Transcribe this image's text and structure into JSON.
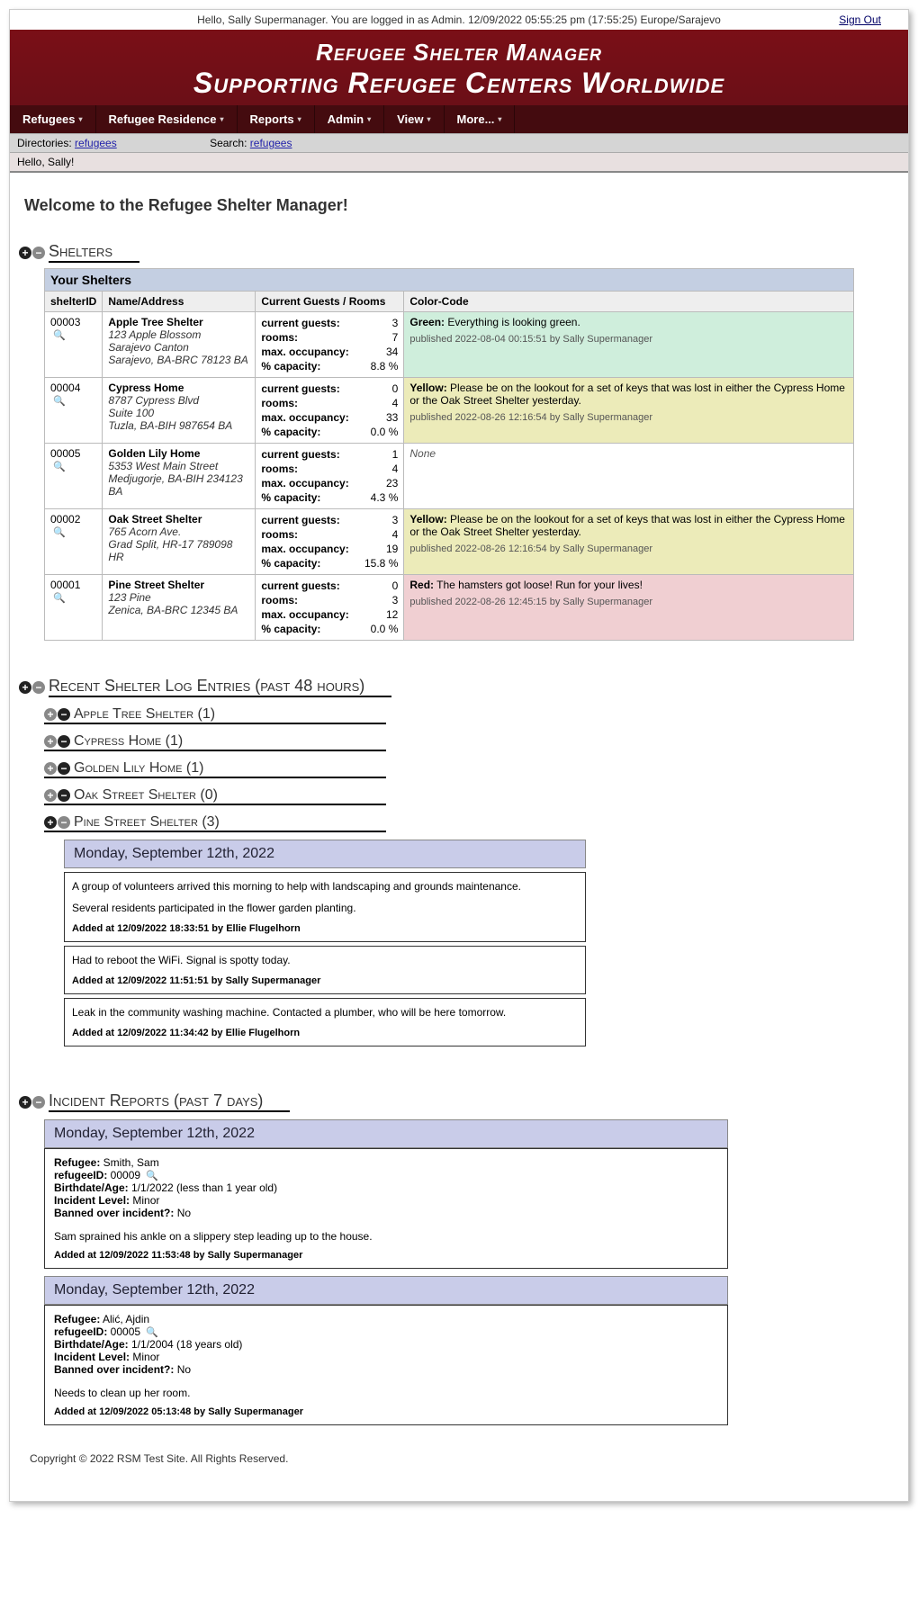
{
  "topbar": {
    "greeting": "Hello, Sally Supermanager. You are logged in as Admin. 12/09/2022 05:55:25 pm (17:55:25) Europe/Sarajevo",
    "signout": "Sign Out"
  },
  "header": {
    "title": "Refugee Shelter Manager",
    "subtitle": "Supporting Refugee Centers Worldwide"
  },
  "nav": [
    "Refugees",
    "Refugee Residence",
    "Reports",
    "Admin",
    "View",
    "More..."
  ],
  "dirbar": {
    "dir_label": "Directories:",
    "dir_link": "refugees",
    "search_label": "Search:",
    "search_link": "refugees"
  },
  "hello": "Hello, Sally!",
  "welcome": "Welcome to the Refugee Shelter Manager!",
  "sections": {
    "shelters": "Shelters",
    "recent": "Recent Shelter Log Entries (past 48 hours)",
    "incidents": "Incident Reports (past 7 days)"
  },
  "table": {
    "caption": "Your Shelters",
    "cols": {
      "id": "shelterID",
      "name": "Name/Address",
      "guests": "Current Guests / Rooms",
      "cc": "Color-Code"
    },
    "stat_labels": {
      "g": "current guests:",
      "r": "rooms:",
      "m": "max. occupancy:",
      "p": "% capacity:"
    }
  },
  "shelters": [
    {
      "id": "00003",
      "name": "Apple Tree Shelter",
      "addr": "123 Apple Blossom\nSarajevo Canton\nSarajevo, BA-BRC 78123 BA",
      "g": "3",
      "r": "7",
      "m": "34",
      "p": "8.8 %",
      "cc_class": "cc-green",
      "cc_label": "Green:",
      "cc_text": "Everything is looking green.",
      "cc_pub": "published 2022-08-04 00:15:51 by Sally Supermanager"
    },
    {
      "id": "00004",
      "name": "Cypress Home",
      "addr": "8787 Cypress Blvd\nSuite 100\nTuzla, BA-BIH 987654 BA",
      "g": "0",
      "r": "4",
      "m": "33",
      "p": "0.0 %",
      "cc_class": "cc-yellow",
      "cc_label": "Yellow:",
      "cc_text": "Please be on the lookout for a set of keys that was lost in either the Cypress Home or the Oak Street Shelter yesterday.",
      "cc_pub": "published 2022-08-26 12:16:54 by Sally Supermanager"
    },
    {
      "id": "00005",
      "name": "Golden Lily Home",
      "addr": "5353 West Main Street\nMedjugorje, BA-BIH 234123 BA",
      "g": "1",
      "r": "4",
      "m": "23",
      "p": "4.3 %",
      "cc_class": "",
      "cc_label": "",
      "cc_text": "None",
      "cc_pub": ""
    },
    {
      "id": "00002",
      "name": "Oak Street Shelter",
      "addr": "765 Acorn Ave.\nGrad Split, HR-17 789098 HR",
      "g": "3",
      "r": "4",
      "m": "19",
      "p": "15.8 %",
      "cc_class": "cc-yellow",
      "cc_label": "Yellow:",
      "cc_text": "Please be on the lookout for a set of keys that was lost in either the Cypress Home or the Oak Street Shelter yesterday.",
      "cc_pub": "published 2022-08-26 12:16:54 by Sally Supermanager"
    },
    {
      "id": "00001",
      "name": "Pine Street Shelter",
      "addr": "123 Pine\nZenica, BA-BRC 12345 BA",
      "g": "0",
      "r": "3",
      "m": "12",
      "p": "0.0 %",
      "cc_class": "cc-red",
      "cc_label": "Red:",
      "cc_text": "The hamsters got loose! Run for your lives!",
      "cc_pub": "published 2022-08-26 12:45:15 by Sally Supermanager"
    }
  ],
  "log_shelters": [
    "Apple Tree Shelter (1)",
    "Cypress Home (1)",
    "Golden Lily Home (1)",
    "Oak Street Shelter (0)",
    "Pine Street Shelter (3)"
  ],
  "log_date": "Monday, September 12th, 2022",
  "logs": [
    {
      "lines": [
        "A group of volunteers arrived this morning to help with landscaping and grounds maintenance.",
        "Several residents participated in the flower garden planting."
      ],
      "meta": "Added at 12/09/2022 18:33:51 by Ellie Flugelhorn"
    },
    {
      "lines": [
        "Had to reboot the WiFi. Signal is spotty today."
      ],
      "meta": "Added at 12/09/2022 11:51:51 by Sally Supermanager"
    },
    {
      "lines": [
        "Leak in the community washing machine. Contacted a plumber, who will be here tomorrow."
      ],
      "meta": "Added at 12/09/2022 11:34:42 by Ellie Flugelhorn"
    }
  ],
  "inc_date": "Monday, September 12th, 2022",
  "incidents": [
    {
      "refugee": "Smith, Sam",
      "rid": "00009",
      "birth": "1/1/2022 (less than 1 year old)",
      "level": "Minor",
      "banned": "No",
      "desc": "Sam sprained his ankle on a slippery step leading up to the house.",
      "meta": "Added at 12/09/2022 11:53:48 by Sally Supermanager"
    },
    {
      "refugee": "Alić, Ajdin",
      "rid": "00005",
      "birth": "1/1/2004 (18 years old)",
      "level": "Minor",
      "banned": "No",
      "desc": "Needs to clean up her room.",
      "meta": "Added at 12/09/2022 05:13:48 by Sally Supermanager"
    }
  ],
  "labels": {
    "refugee": "Refugee:",
    "rid": "refugeeID:",
    "birth": "Birthdate/Age:",
    "level": "Incident Level:",
    "banned": "Banned over incident?:"
  },
  "footer": "Copyright © 2022 RSM Test Site. All Rights Reserved."
}
